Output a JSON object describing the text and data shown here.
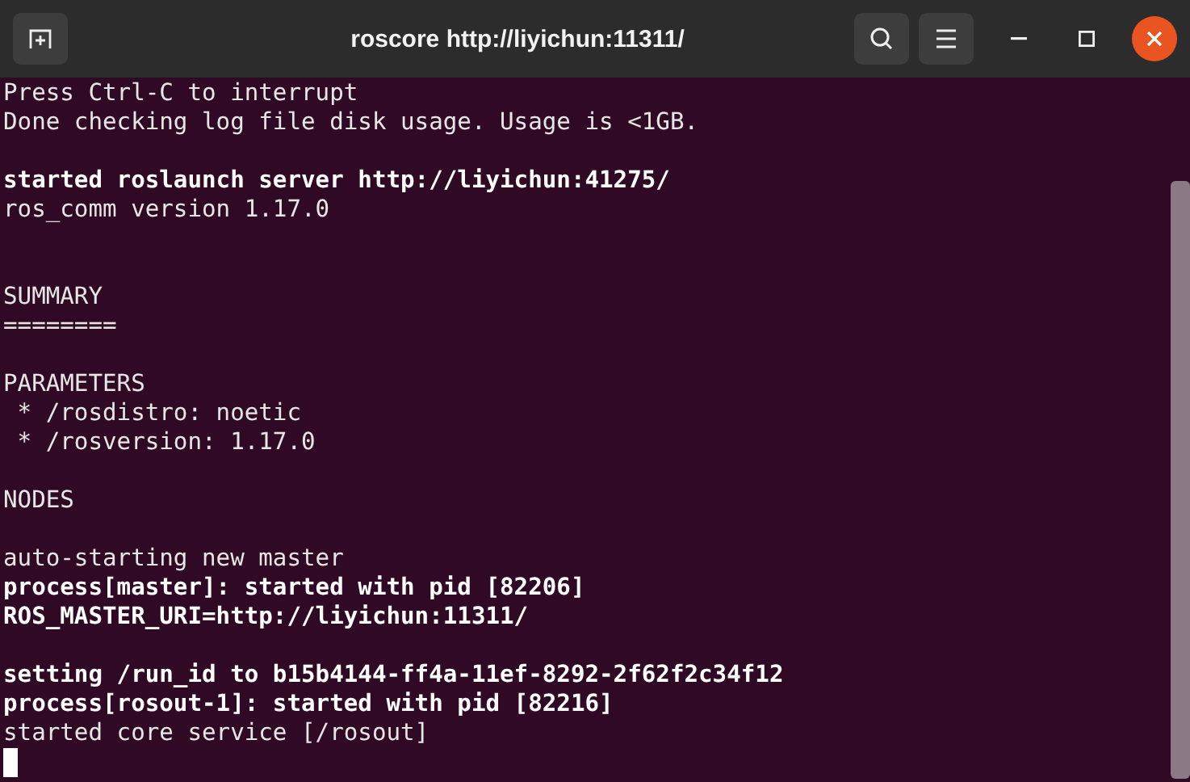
{
  "window": {
    "title": "roscore http://liyichun:11311/"
  },
  "lines": [
    {
      "kind": "plain",
      "text": "Press Ctrl-C to interrupt"
    },
    {
      "kind": "plain",
      "text": "Done checking log file disk usage. Usage is <1GB."
    },
    {
      "kind": "blank"
    },
    {
      "kind": "bold",
      "text": "started roslaunch server http://liyichun:41275/"
    },
    {
      "kind": "plain",
      "text": "ros_comm version 1.17.0"
    },
    {
      "kind": "blank"
    },
    {
      "kind": "blank"
    },
    {
      "kind": "plain",
      "text": "SUMMARY"
    },
    {
      "kind": "plain",
      "text": "========"
    },
    {
      "kind": "blank"
    },
    {
      "kind": "plain",
      "text": "PARAMETERS"
    },
    {
      "kind": "plain",
      "text": " * /rosdistro: noetic"
    },
    {
      "kind": "plain",
      "text": " * /rosversion: 1.17.0"
    },
    {
      "kind": "blank"
    },
    {
      "kind": "plain",
      "text": "NODES"
    },
    {
      "kind": "blank"
    },
    {
      "kind": "plain",
      "text": "auto-starting new master"
    },
    {
      "kind": "bold",
      "text": "process[master]: started with pid [82206]"
    },
    {
      "kind": "bold",
      "text": "ROS_MASTER_URI=http://liyichun:11311/"
    },
    {
      "kind": "blank"
    },
    {
      "kind": "bold",
      "text": "setting /run_id to b15b4144-ff4a-11ef-8292-2f62f2c34f12"
    },
    {
      "kind": "bold",
      "text": "process[rosout-1]: started with pid [82216]"
    },
    {
      "kind": "plain",
      "text": "started core service [/rosout]"
    },
    {
      "kind": "cursor"
    }
  ]
}
